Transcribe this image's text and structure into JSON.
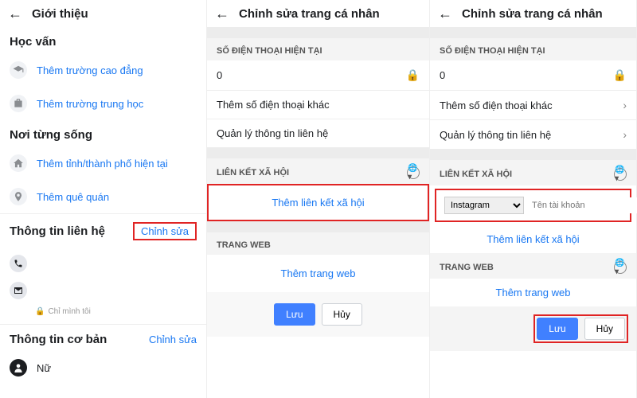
{
  "link_color": "#1877f2",
  "panel1": {
    "back": "←",
    "title": "Giới thiệu",
    "education_header": "Học vấn",
    "add_college": "Thêm trường cao đẳng",
    "add_highschool": "Thêm trường trung học",
    "places_header": "Nơi từng sống",
    "add_current_city": "Thêm tỉnh/thành phố hiện tại",
    "add_hometown": "Thêm quê quán",
    "contact_header": "Thông tin liên hệ",
    "edit": "Chỉnh sửa",
    "privacy_only_me": "Chỉ mình tôi",
    "basic_header": "Thông tin cơ bản",
    "gender": "Nữ"
  },
  "panel2": {
    "back": "←",
    "title": "Chỉnh sửa trang cá nhân",
    "phone_header": "SỐ ĐIỆN THOẠI HIỆN TẠI",
    "phone_value": "0",
    "add_phone": "Thêm số điện thoại khác",
    "manage_contact": "Quản lý thông tin liên hệ",
    "social_header": "LIÊN KẾT XÃ HỘI",
    "add_social": "Thêm liên kết xã hội",
    "web_header": "TRANG WEB",
    "add_web": "Thêm trang web",
    "save": "Lưu",
    "cancel": "Hủy"
  },
  "panel3": {
    "back": "←",
    "title": "Chỉnh sửa trang cá nhân",
    "phone_header": "SỐ ĐIỆN THOẠI HIỆN TẠI",
    "phone_value": "0",
    "add_phone": "Thêm số điện thoại khác",
    "manage_contact": "Quản lý thông tin liên hệ",
    "social_header": "LIÊN KẾT XÃ HỘI",
    "social_platform": "Instagram",
    "username_placeholder": "Tên tài khoản",
    "add_social": "Thêm liên kết xã hội",
    "web_header": "TRANG WEB",
    "add_web": "Thêm trang web",
    "save": "Lưu",
    "cancel": "Hủy"
  }
}
